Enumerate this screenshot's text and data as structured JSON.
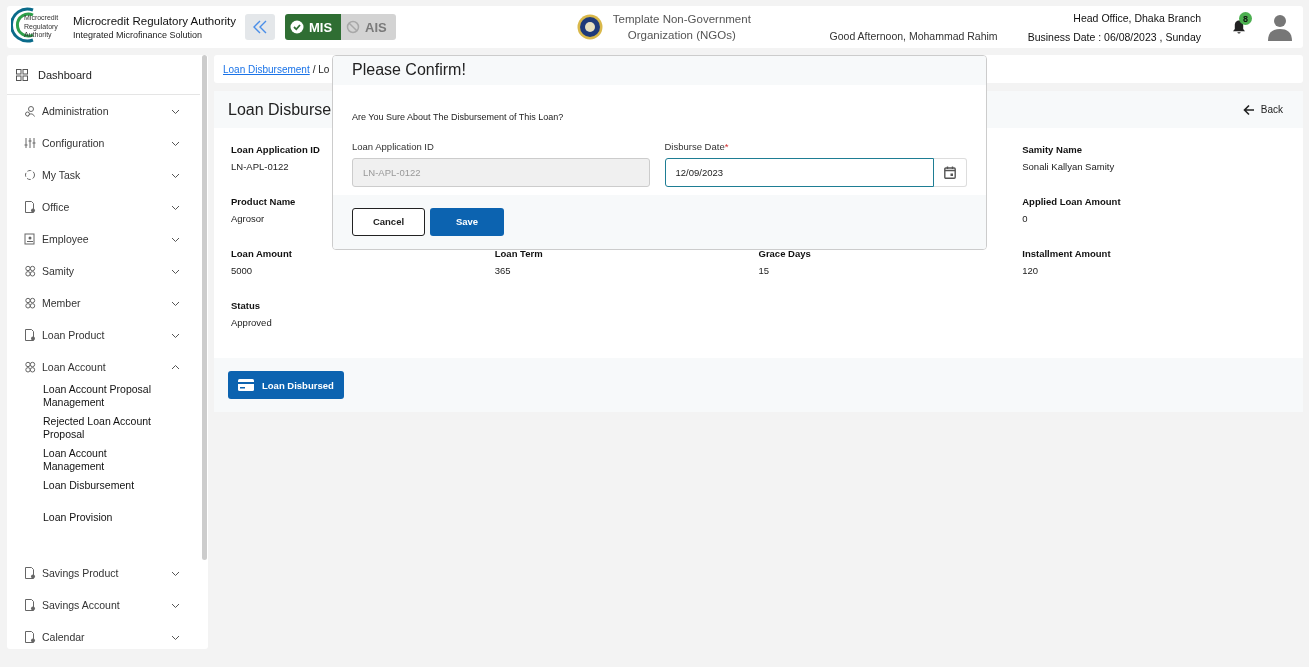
{
  "header": {
    "org_name": "Microcredit Regulatory Authority",
    "org_subtitle": "Integrated Microfinance Solution",
    "logo_text": [
      "Microcredit",
      "Regulatory",
      "Authority"
    ],
    "modules": [
      {
        "label": "MIS",
        "selected": true
      },
      {
        "label": "AIS",
        "selected": false
      }
    ],
    "organization": [
      "Template Non-Government",
      "Organization (NGOs)"
    ],
    "greeting": "Good Afternoon, Mohammad Rahim",
    "branch": "Head Office, Dhaka Branch",
    "business_date": "Business Date : 06/08/2023 , Sunday",
    "notification_count": "8"
  },
  "sidebar": {
    "dashboard": "Dashboard",
    "items": [
      {
        "label": "Administration",
        "expanded": false
      },
      {
        "label": "Configuration",
        "expanded": false
      },
      {
        "label": "My Task",
        "expanded": false
      },
      {
        "label": "Office",
        "expanded": false
      },
      {
        "label": "Employee",
        "expanded": false
      },
      {
        "label": "Samity",
        "expanded": false
      },
      {
        "label": "Member",
        "expanded": false
      },
      {
        "label": "Loan Product",
        "expanded": false
      },
      {
        "label": "Loan Account",
        "expanded": true,
        "children": [
          {
            "label": "Loan Account Proposal Management"
          },
          {
            "label": "Rejected Loan Account Proposal"
          },
          {
            "label": "Loan Account Management"
          },
          {
            "label": "Loan Disbursement"
          },
          {
            "label": "Loan Provision"
          }
        ]
      },
      {
        "label": "Savings Product",
        "expanded": false
      },
      {
        "label": "Savings Account",
        "expanded": false
      },
      {
        "label": "Calendar",
        "expanded": false
      }
    ]
  },
  "breadcrumb": {
    "link": "Loan Disbursement",
    "rest": "/ Lo"
  },
  "page": {
    "title": "Loan Disburse",
    "back": "Back",
    "rows": [
      [
        {
          "label": "Loan Application ID",
          "value": "LN-APL-0122"
        },
        null,
        null,
        {
          "label": "Samity Name",
          "value": "Sonali Kallyan Samity"
        }
      ],
      [
        {
          "label": "Product Name",
          "value": "Agrosor"
        },
        null,
        null,
        {
          "label": "Applied Loan Amount",
          "value": "0"
        }
      ],
      [
        {
          "label": "Loan Amount",
          "value": "5000"
        },
        {
          "label": "Loan Term",
          "value": "365"
        },
        {
          "label": "Grace Days",
          "value": "15"
        },
        {
          "label": "Installment Amount",
          "value": "120"
        }
      ],
      [
        {
          "label": "Status",
          "value": "Approved"
        },
        null,
        null,
        null
      ]
    ],
    "action": "Loan Disbursed"
  },
  "dialog": {
    "title": "Please Confirm!",
    "message": "Are You Sure About The Disbursement of This Loan?",
    "required_mark": "*",
    "fields": [
      {
        "label": "Loan Application ID",
        "value": "LN-APL-0122",
        "disabled": true,
        "required": false,
        "kind": "text"
      },
      {
        "label": "Disburse Date",
        "value": "12/09/2023",
        "disabled": false,
        "required": true,
        "kind": "date"
      }
    ],
    "buttons": [
      {
        "label": "Cancel",
        "kind": "secondary"
      },
      {
        "label": "Save",
        "kind": "primary"
      }
    ]
  }
}
